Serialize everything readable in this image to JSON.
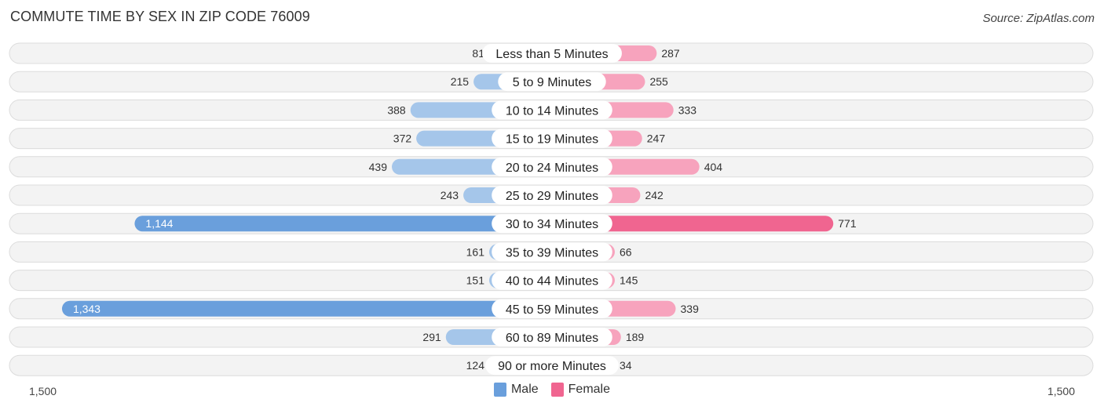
{
  "title": "COMMUTE TIME BY SEX IN ZIP CODE 76009",
  "source": "Source: ZipAtlas.com",
  "colors": {
    "male": "#6a9fdc",
    "male_light": "#a5c6ea",
    "female": "#f06590",
    "female_light": "#f7a3bd"
  },
  "chart_data": {
    "type": "bar",
    "orientation": "horizontal-diverging",
    "title": "COMMUTE TIME BY SEX IN ZIP CODE 76009",
    "categories": [
      "Less than 5 Minutes",
      "5 to 9 Minutes",
      "10 to 14 Minutes",
      "15 to 19 Minutes",
      "20 to 24 Minutes",
      "25 to 29 Minutes",
      "30 to 34 Minutes",
      "35 to 39 Minutes",
      "40 to 44 Minutes",
      "45 to 59 Minutes",
      "60 to 89 Minutes",
      "90 or more Minutes"
    ],
    "series": [
      {
        "name": "Male",
        "values": [
          81,
          215,
          388,
          372,
          439,
          243,
          1144,
          161,
          151,
          1343,
          291,
          124
        ]
      },
      {
        "name": "Female",
        "values": [
          287,
          255,
          333,
          247,
          404,
          242,
          771,
          66,
          145,
          339,
          189,
          34
        ]
      }
    ],
    "value_labels": {
      "Male": [
        "81",
        "215",
        "388",
        "372",
        "439",
        "243",
        "1,144",
        "161",
        "151",
        "1,343",
        "291",
        "124"
      ],
      "Female": [
        "287",
        "255",
        "333",
        "247",
        "404",
        "242",
        "771",
        "66",
        "145",
        "339",
        "189",
        "34"
      ]
    },
    "xlim": [
      -1500,
      1500
    ],
    "axis_ticks": [
      "1,500",
      "1,500"
    ],
    "legend": [
      "Male",
      "Female"
    ],
    "legend_position": "bottom-center",
    "grid": false
  }
}
